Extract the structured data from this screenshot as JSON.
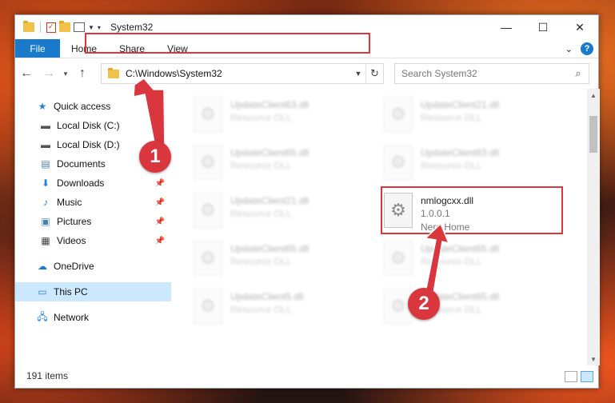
{
  "window": {
    "title": "System32",
    "controls": {
      "minimize": "—",
      "maximize": "☐",
      "close": "✕"
    }
  },
  "ribbon": {
    "file": "File",
    "tabs": [
      "Home",
      "Share",
      "View"
    ],
    "help": "?",
    "expand": "⌄"
  },
  "address": {
    "path": "C:\\Windows\\System32",
    "search_placeholder": "Search System32"
  },
  "sidebar": {
    "quick_access": "Quick access",
    "items": [
      {
        "label": "Local Disk (C:)",
        "icon": "drive-icon",
        "glyph": "▬"
      },
      {
        "label": "Local Disk (D:)",
        "icon": "drive-icon",
        "glyph": "▬"
      },
      {
        "label": "Documents",
        "icon": "documents-icon",
        "glyph": "▤"
      },
      {
        "label": "Downloads",
        "icon": "download-icon",
        "glyph": "⬇"
      },
      {
        "label": "Music",
        "icon": "music-icon",
        "glyph": "♪"
      },
      {
        "label": "Pictures",
        "icon": "pictures-icon",
        "glyph": "▣"
      },
      {
        "label": "Videos",
        "icon": "videos-icon",
        "glyph": "▦"
      }
    ],
    "onedrive": "OneDrive",
    "thispc": "This PC",
    "network": "Network"
  },
  "files": [
    {
      "name": "UpdateClient63.dll",
      "sub1": "Resource DLL",
      "sub2": ""
    },
    {
      "name": "UpdateClient21.dll",
      "sub1": "Resource DLL",
      "sub2": ""
    },
    {
      "name": "UpdateClient65.dll",
      "sub1": "Resource DLL",
      "sub2": ""
    },
    {
      "name": "UpdateClient63.dll",
      "sub1": "Resource DLL",
      "sub2": ""
    },
    {
      "name": "UpdateClient21.dll",
      "sub1": "Resource DLL",
      "sub2": ""
    },
    {
      "name": "nmlogcxx.dll",
      "sub1": "1.0.0.1",
      "sub2": "Nero Home"
    },
    {
      "name": "UpdateClient65.dll",
      "sub1": "Resource DLL",
      "sub2": ""
    },
    {
      "name": "UpdateClient65.dll",
      "sub1": "Resource DLL",
      "sub2": ""
    },
    {
      "name": "UpdateClient5.dll",
      "sub1": "Resource DLL",
      "sub2": ""
    },
    {
      "name": "UpdateClient65.dll",
      "sub1": "Resource DLL",
      "sub2": ""
    }
  ],
  "status": {
    "count": "191 items"
  },
  "callouts": [
    "1",
    "2"
  ],
  "colors": {
    "accent": "#1979ca",
    "highlight": "#d9363e",
    "selection": "#cce8ff"
  }
}
